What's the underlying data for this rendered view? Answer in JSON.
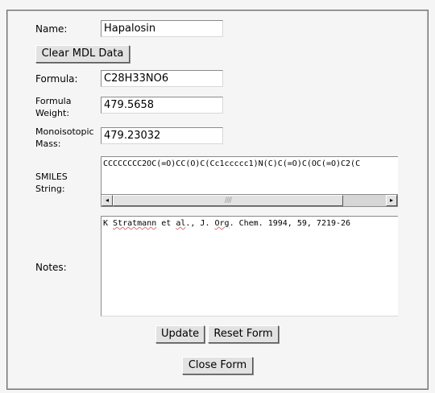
{
  "fields": {
    "name": {
      "label": "Name:",
      "value": "Hapalosin"
    },
    "formula": {
      "label": "Formula:",
      "value": "C28H33NO6"
    },
    "formula_weight": {
      "label_line1": "Formula",
      "label_line2": "Weight:",
      "value": "479.5658"
    },
    "monoisotopic_mass": {
      "label_line1": "Monoisotopic",
      "label_line2": "Mass:",
      "value": "479.23032"
    },
    "smiles": {
      "label_line1": "SMILES",
      "label_line2": "String:",
      "value": "CCCCCCCC2OC(=O)CC(O)C(Cc1ccccc1)N(C)C(=O)C(OC(=O)C2(C"
    },
    "notes": {
      "label": "Notes:",
      "parts": [
        "K ",
        "Stratmann",
        " et ",
        "al",
        "., J. ",
        "Org",
        ". Chem. 1994, 59, 7219-26"
      ]
    }
  },
  "buttons": {
    "clear_mdl": "Clear MDL Data",
    "update": "Update",
    "reset": "Reset Form",
    "close": "Close Form"
  },
  "scrollbar": {
    "left_arrow": "◂",
    "right_arrow": "▸",
    "grip": "////"
  }
}
